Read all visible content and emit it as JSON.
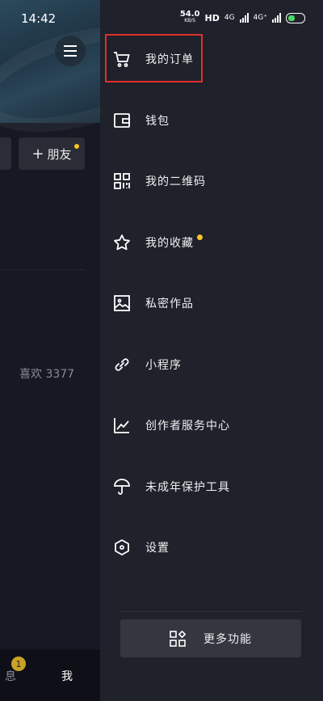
{
  "status_bar": {
    "time": "14:42",
    "net_speed_value": "54.0",
    "net_speed_unit": "KB/S",
    "hd": "HD",
    "net1": "4G",
    "net2": "4G⁺"
  },
  "left_panel": {
    "add_friend": "朋友",
    "add_friend_plus": "+",
    "likes": "喜欢 3377",
    "bottom_message": "息",
    "badge": "1",
    "bottom_me": "我"
  },
  "drawer": {
    "items": [
      {
        "label": "我的订单",
        "icon": "cart-icon"
      },
      {
        "label": "钱包",
        "icon": "wallet-icon"
      },
      {
        "label": "我的二维码",
        "icon": "qr-code-icon"
      },
      {
        "label": "我的收藏",
        "icon": "star-icon",
        "new_dot": true
      },
      {
        "label": "私密作品",
        "icon": "image-icon"
      },
      {
        "label": "小程序",
        "icon": "link-icon"
      },
      {
        "label": "创作者服务中心",
        "icon": "chart-icon"
      },
      {
        "label": "未成年保护工具",
        "icon": "umbrella-icon"
      },
      {
        "label": "设置",
        "icon": "settings-icon"
      }
    ],
    "more_button": "更多功能"
  },
  "colors": {
    "drawer_bg": "#1f212b",
    "highlight": "#e0302b",
    "dot": "#f5c523"
  }
}
